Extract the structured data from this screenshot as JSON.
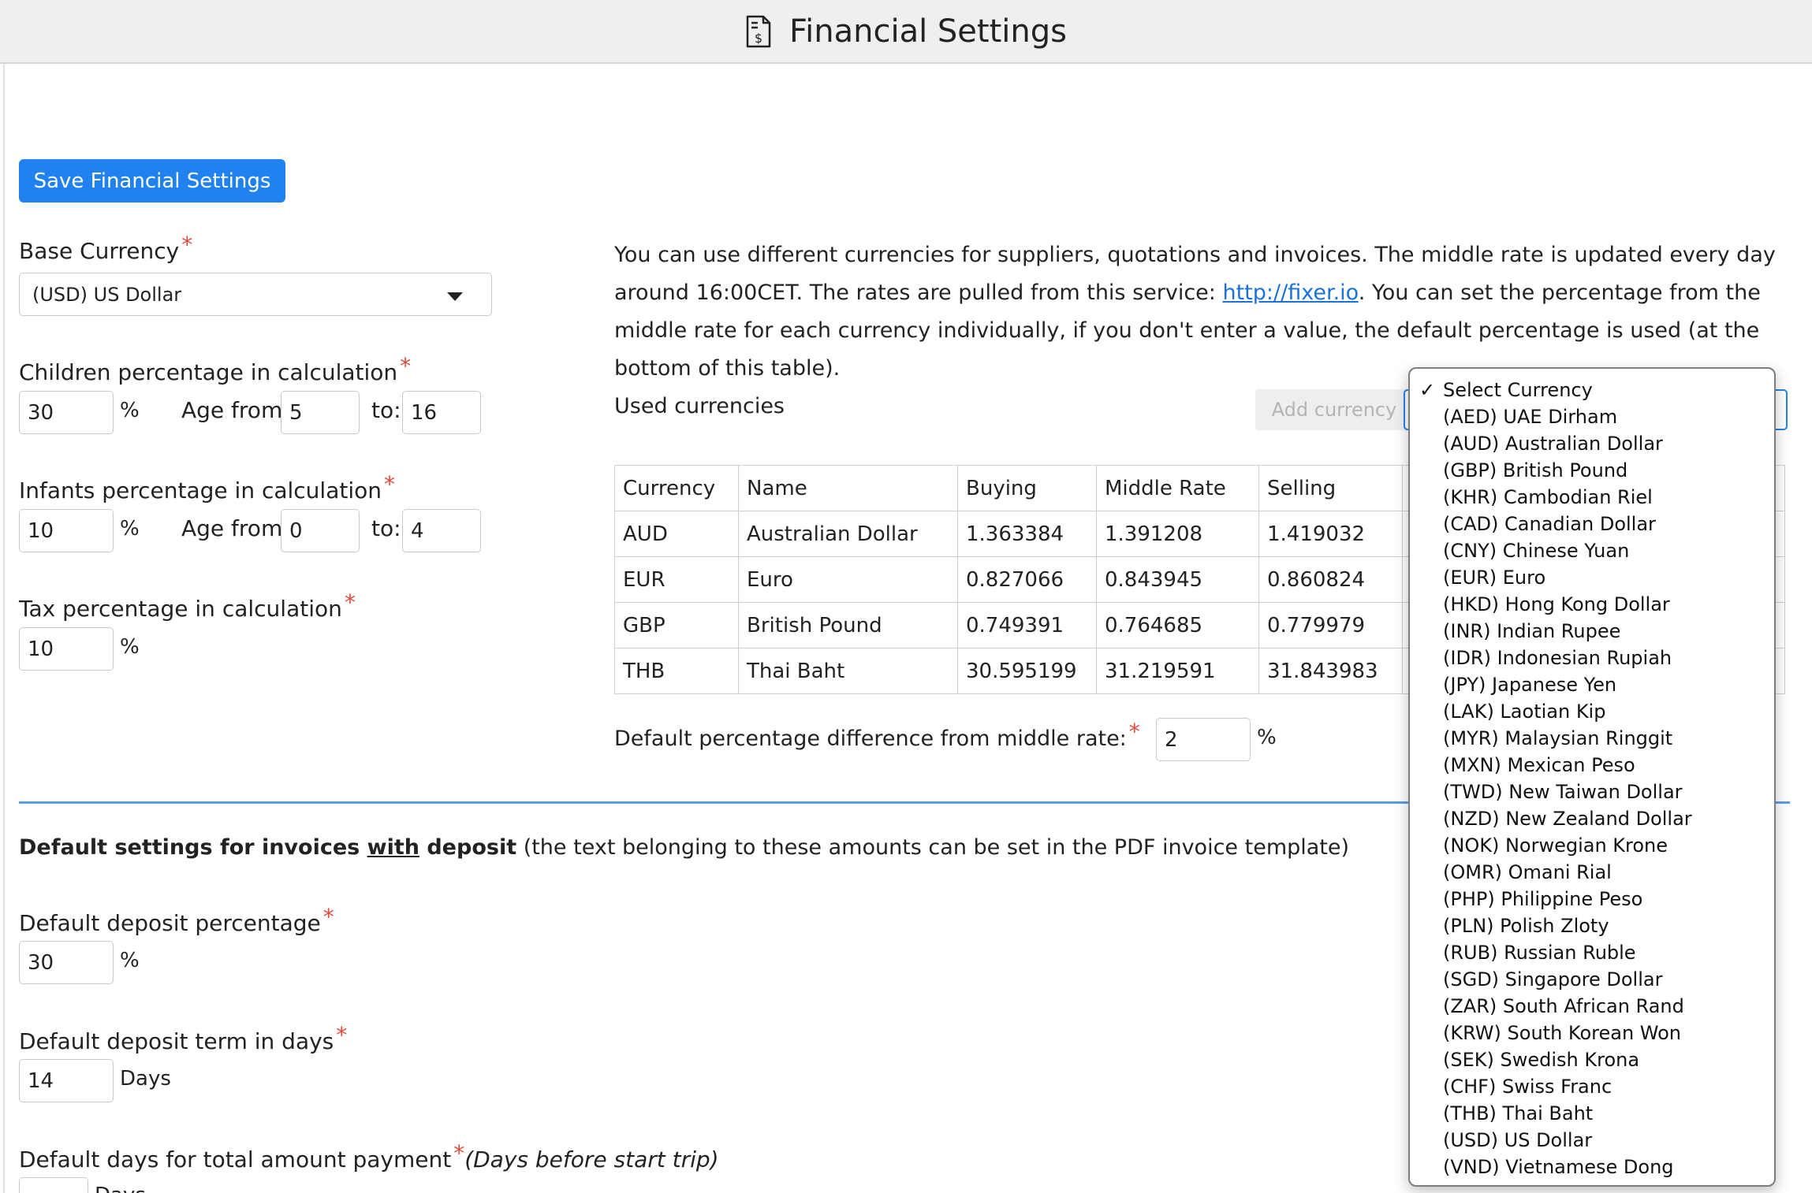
{
  "header": {
    "title": "Financial Settings",
    "icon": "invoice-dollar-icon"
  },
  "toolbar": {
    "save_label": "Save Financial Settings"
  },
  "base_currency": {
    "label": "Base Currency",
    "value": "(USD) US Dollar"
  },
  "children": {
    "label": "Children percentage in calculation",
    "percent": "30",
    "age_from_label": "Age from:",
    "age_from": "5",
    "to_label": "to:",
    "age_to": "16"
  },
  "infants": {
    "label": "Infants percentage in calculation",
    "percent": "10",
    "age_from_label": "Age from:",
    "age_from": "0",
    "to_label": "to:",
    "age_to": "4"
  },
  "tax": {
    "label": "Tax percentage in calculation",
    "percent": "10"
  },
  "percent_sign": "%",
  "required_mark": "*",
  "info": {
    "text_before_link": "You can use different currencies for suppliers, quotations and invoices. The middle rate is updated every day around 16:00CET. The rates are pulled from this service: ",
    "link_text": "http://fixer.io",
    "text_after_link": ". You can set the percentage from the middle rate for each currency individually, if you don't enter a value, the default percentage is used (at the bottom of this table)."
  },
  "used_currencies": {
    "heading": "Used currencies",
    "add_button": "Add currency",
    "columns": [
      "Currency",
      "Name",
      "Buying",
      "Middle Rate",
      "Selling"
    ],
    "rows": [
      [
        "AUD",
        "Australian Dollar",
        "1.363384",
        "1.391208",
        "1.419032"
      ],
      [
        "EUR",
        "Euro",
        "0.827066",
        "0.843945",
        "0.860824"
      ],
      [
        "GBP",
        "British Pound",
        "0.749391",
        "0.764685",
        "0.779979"
      ],
      [
        "THB",
        "Thai Baht",
        "30.595199",
        "31.219591",
        "31.843983"
      ]
    ]
  },
  "default_pct": {
    "label": "Default percentage difference from middle rate:",
    "value": "2"
  },
  "deposit_section": {
    "heading_bold_1": "Default settings for invoices ",
    "heading_underlined": "with",
    "heading_bold_2": " deposit",
    "heading_note": " (the text belonging to these amounts can be set in the PDF invoice template)"
  },
  "deposit_pct": {
    "label": "Default deposit percentage",
    "value": "30"
  },
  "deposit_term": {
    "label": "Default deposit term in days",
    "value": "14",
    "unit": "Days"
  },
  "total_payment": {
    "label": "Default days for total amount payment",
    "note": "(Days before start trip)"
  },
  "currency_dropdown": {
    "selected": "Select Currency",
    "options": [
      "Select Currency",
      "(AED) UAE Dirham",
      "(AUD) Australian Dollar",
      "(GBP) British Pound",
      "(KHR) Cambodian Riel",
      "(CAD) Canadian Dollar",
      "(CNY) Chinese Yuan",
      "(EUR) Euro",
      "(HKD) Hong Kong Dollar",
      "(INR) Indian Rupee",
      "(IDR) Indonesian Rupiah",
      "(JPY) Japanese Yen",
      "(LAK) Laotian Kip",
      "(MYR) Malaysian Ringgit",
      "(MXN) Mexican Peso",
      "(TWD) New Taiwan Dollar",
      "(NZD) New Zealand Dollar",
      "(NOK) Norwegian Krone",
      "(OMR) Omani Rial",
      "(PHP) Philippine Peso",
      "(PLN) Polish Zloty",
      "(RUB) Russian Ruble",
      "(SGD) Singapore Dollar",
      "(ZAR) South African Rand",
      "(KRW) South Korean Won",
      "(SEK) Swedish Krona",
      "(CHF) Swiss Franc",
      "(THB) Thai Baht",
      "(USD) US Dollar",
      "(VND) Vietnamese Dong"
    ]
  }
}
